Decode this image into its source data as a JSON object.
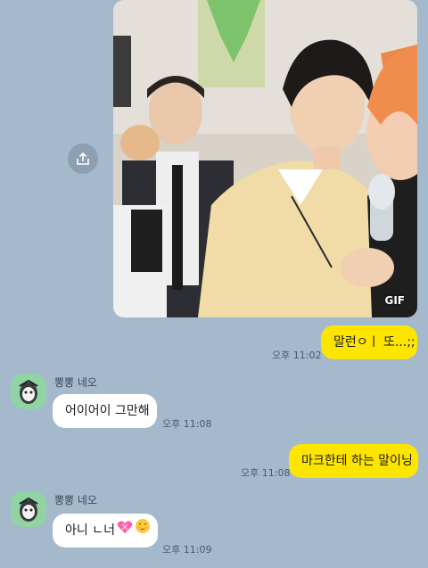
{
  "gif_message": {
    "badge": "GIF",
    "share_icon": "share-icon"
  },
  "messages": [
    {
      "side": "me",
      "text": "말런ㅇㅣ 또...;;",
      "time": "오후 11:02"
    },
    {
      "side": "them",
      "sender": "뽕뽕 네오",
      "text": "어이어이 그만해",
      "time": "오후 11:08"
    },
    {
      "side": "me",
      "text": "마크한테 하는 말이닝",
      "time": "오후 11:08"
    },
    {
      "side": "them",
      "sender": "뽕뽕 네오",
      "text": "아니 ㄴ너",
      "emojis": [
        "heart-with-ribbon-emoji",
        "blushing-face-emoji"
      ],
      "time": "오후 11:09"
    }
  ],
  "colors": {
    "background": "#a5b9cc",
    "my_bubble": "#fee500",
    "their_bubble": "#ffffff",
    "avatar_bg": "#8fd4a2"
  }
}
